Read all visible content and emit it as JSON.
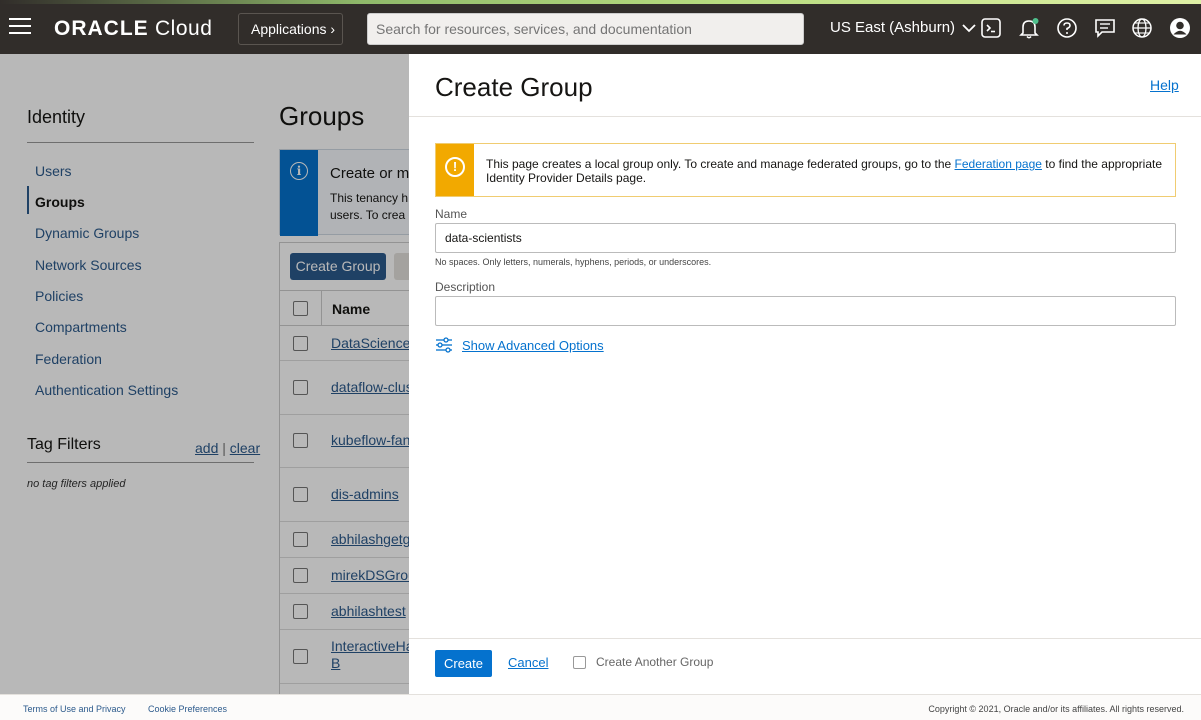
{
  "topbar": {
    "logo_brand": "ORACLE",
    "logo_product": "Cloud",
    "apps_label": "Applications",
    "search_placeholder": "Search for resources, services, and documentation",
    "region_label": "US East (Ashburn)",
    "icons": [
      "menu-icon",
      "cloud-shell-icon",
      "bell-icon",
      "help-icon",
      "chat-icon",
      "globe-icon",
      "profile-icon"
    ],
    "colors": {
      "bar": "#312d2a",
      "stripe": "#b8dc80"
    }
  },
  "leftnav": {
    "title": "Identity",
    "items": [
      {
        "label": "Users",
        "active": false
      },
      {
        "label": "Groups",
        "active": true
      },
      {
        "label": "Dynamic Groups",
        "active": false
      },
      {
        "label": "Network Sources",
        "active": false
      },
      {
        "label": "Policies",
        "active": false
      },
      {
        "label": "Compartments",
        "active": false
      },
      {
        "label": "Federation",
        "active": false
      },
      {
        "label": "Authentication Settings",
        "active": false
      }
    ],
    "tag_title": "Tag Filters",
    "tag_add": "add",
    "tag_sep": "|",
    "tag_clear": "clear",
    "tag_note": "no tag filters applied"
  },
  "groups": {
    "title": "Groups",
    "info_heading": "Create or m",
    "info_line1": "This tenancy h",
    "info_line2": "users. To crea",
    "create_btn": "Create Group",
    "col_name": "Name",
    "rows": [
      {
        "name": "DataScienceG"
      },
      {
        "name": "dataflow-clust"
      },
      {
        "name": "kubeflow-fans"
      },
      {
        "name": "dis-admins"
      },
      {
        "name": "abhilashgetgr"
      },
      {
        "name": "mirekDSGrou"
      },
      {
        "name": "abhilashtest"
      },
      {
        "name": "InteractiveHa",
        "name2": "B"
      }
    ]
  },
  "panel": {
    "title": "Create Group",
    "help": "Help",
    "warning_pre": "This page creates a local group only. To create and manage federated groups, go to the ",
    "warning_link": "Federation page",
    "warning_post": " to find the appropriate Identity Provider Details page.",
    "name_label": "Name",
    "name_value": "data-scientists",
    "name_hint": "No spaces. Only letters, numerals, hyphens, periods, or underscores.",
    "desc_label": "Description",
    "desc_value": "",
    "advanced": "Show Advanced Options",
    "create": "Create",
    "cancel": "Cancel",
    "create_another": "Create Another Group",
    "colors": {
      "primary": "#0572ce",
      "warning": "#f2a900"
    }
  },
  "footer": {
    "terms": "Terms of Use and Privacy",
    "cookies": "Cookie Preferences",
    "copyright": "Copyright © 2021, Oracle and/or its affiliates. All rights reserved."
  }
}
